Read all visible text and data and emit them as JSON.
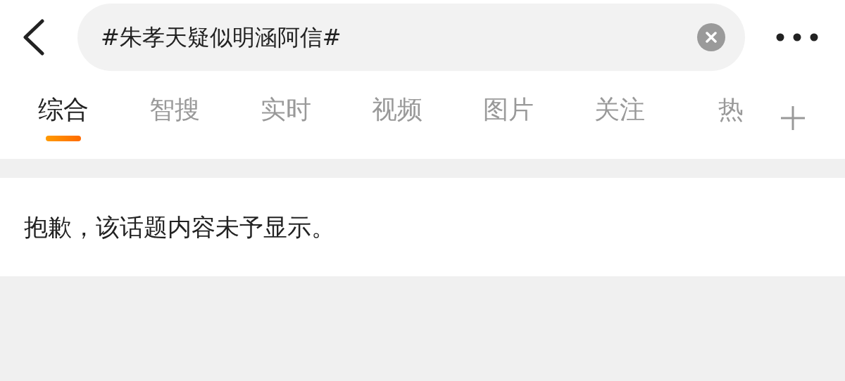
{
  "search": {
    "value": "#朱孝天疑似明涵阿信#"
  },
  "tabs": [
    {
      "label": "综合",
      "selected": true
    },
    {
      "label": "智搜",
      "selected": false
    },
    {
      "label": "实时",
      "selected": false
    },
    {
      "label": "视频",
      "selected": false
    },
    {
      "label": "图片",
      "selected": false
    },
    {
      "label": "关注",
      "selected": false
    },
    {
      "label": "热",
      "selected": false
    }
  ],
  "notice": "抱歉，该话题内容未予显示。"
}
